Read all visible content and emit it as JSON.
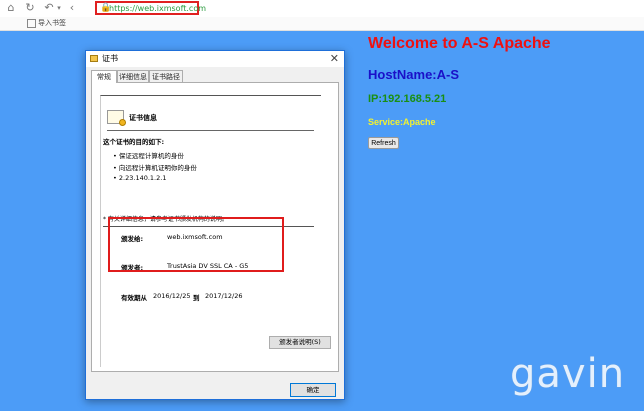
{
  "browser": {
    "url": "https://web.ixmsoft.com",
    "bookmark_label": "导入书签"
  },
  "page": {
    "welcome": "Welcome to A-S Apache",
    "hostname": "HostName:A-S",
    "ip": "IP:192.168.5.21",
    "service": "Service:Apache",
    "refresh_label": "Refresh",
    "background_color": "#4c9cf7",
    "watermark": "gavin"
  },
  "dialog": {
    "title": "证书",
    "tabs": [
      "常规",
      "详细信息",
      "证书路径"
    ],
    "cert_info_title": "证书信息",
    "purpose_title": "这个证书的目的如下:",
    "purposes": [
      "• 保证远程计算机的身份",
      "• 向远程计算机证明你的身份",
      "• 2.23.140.1.2.1"
    ],
    "note": "* 有关详细信息，请参考证书颁发机构的说明。",
    "issued_to_label": "颁发给:",
    "issued_to_value": "web.ixmsoft.com",
    "issued_by_label": "颁发者:",
    "issued_by_value": "TrustAsia DV SSL CA - G5",
    "validity_label": "有效期从",
    "validity_from": "2016/12/25",
    "validity_to_word": "到",
    "validity_to": "2017/12/26",
    "issuer_statement_button": "颁发者说明(S)",
    "ok_button": "确定"
  }
}
